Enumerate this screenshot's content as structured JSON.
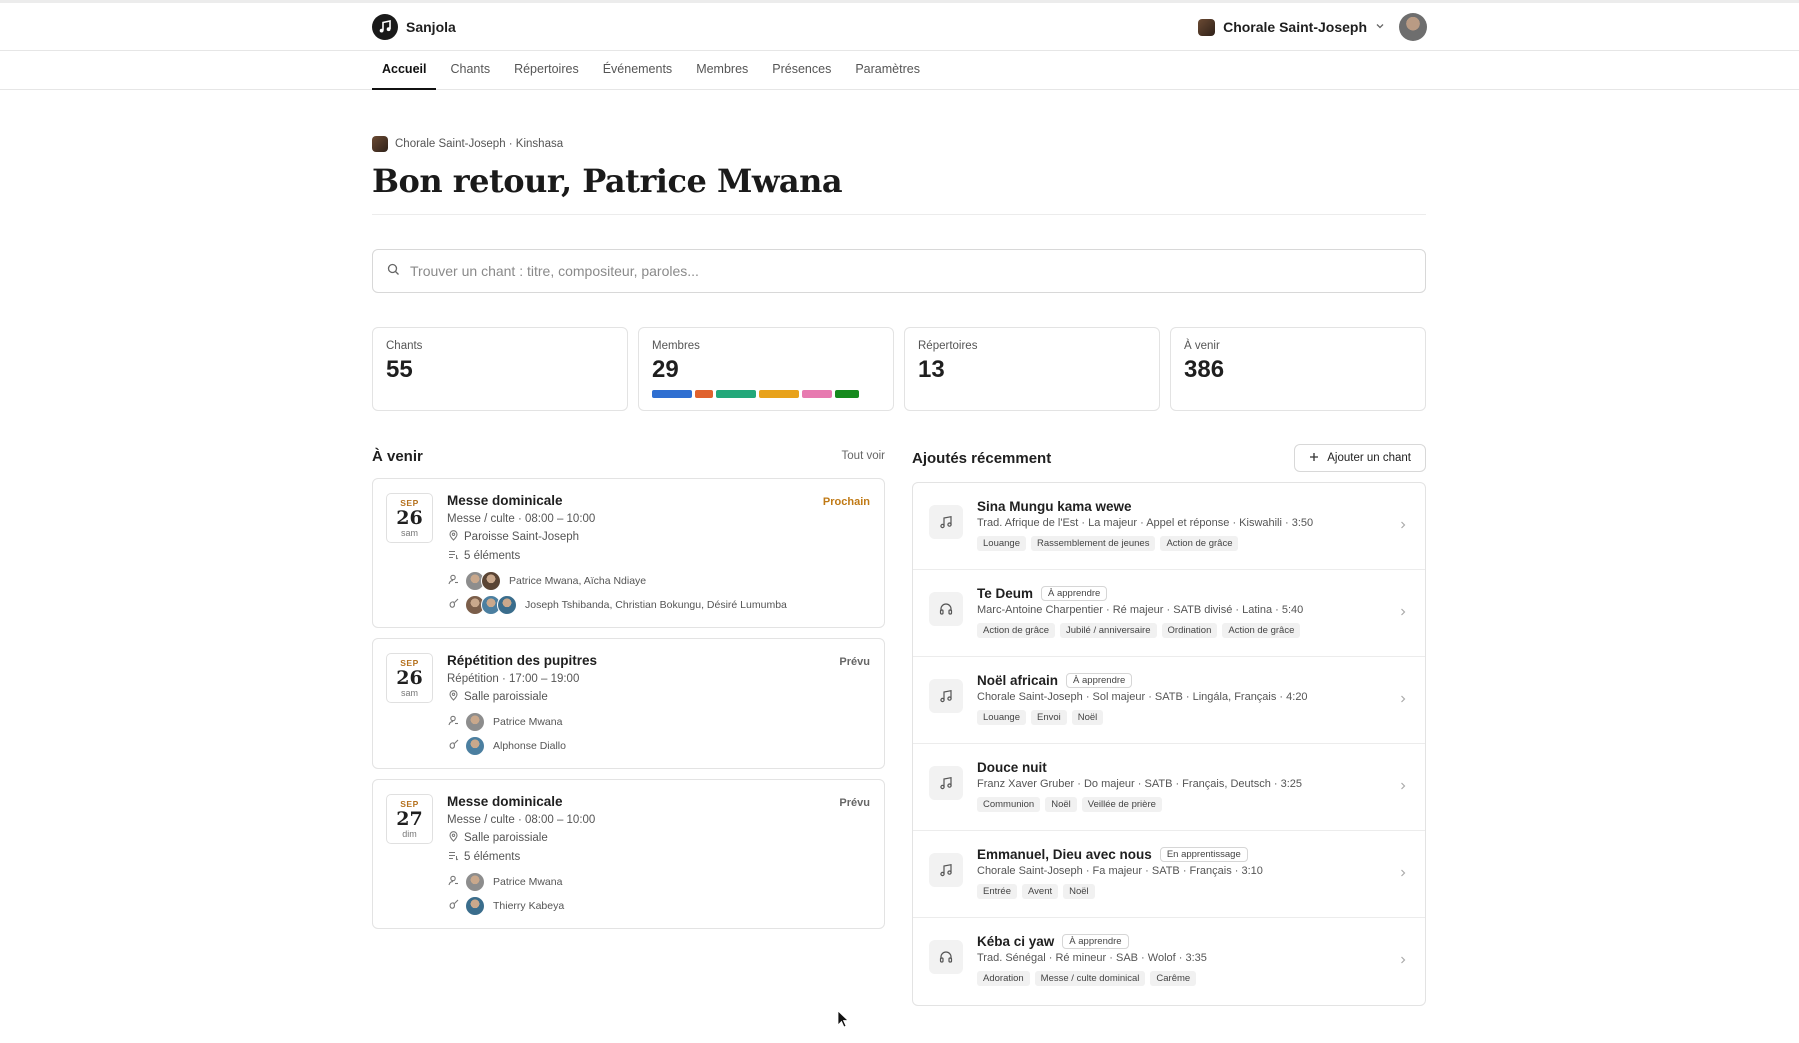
{
  "app": {
    "name": "Sanjola"
  },
  "org": {
    "name": "Chorale Saint-Joseph"
  },
  "tabs": [
    "Accueil",
    "Chants",
    "Répertoires",
    "Événements",
    "Membres",
    "Présences",
    "Paramètres"
  ],
  "breadcrumb": "Chorale Saint-Joseph · Kinshasa",
  "greeting": "Bon retour, Patrice Mwana",
  "search": {
    "placeholder": "Trouver un chant : titre, compositeur, paroles..."
  },
  "stats": [
    {
      "label": "Chants",
      "value": "55"
    },
    {
      "label": "Membres",
      "value": "29"
    },
    {
      "label": "Répertoires",
      "value": "13"
    },
    {
      "label": "À venir",
      "value": "386"
    }
  ],
  "voice_segments": [
    {
      "color": "#2f6fd1",
      "share": 0.2
    },
    {
      "color": "#e0622e",
      "share": 0.09
    },
    {
      "color": "#23a87a",
      "share": 0.2
    },
    {
      "color": "#e8a21b",
      "share": 0.2
    },
    {
      "color": "#e77ab0",
      "share": 0.15
    },
    {
      "color": "#168a1e",
      "share": 0.12
    }
  ],
  "upcoming": {
    "title": "À venir",
    "see_all": "Tout voir",
    "events": [
      {
        "month": "SEP",
        "day": "26",
        "weekday": "sam",
        "title": "Messe dominicale",
        "status": "Prochain",
        "is_next": true,
        "type_time": "Messe / culte · 08:00 – 10:00",
        "place": "Paroisse Saint-Joseph",
        "items": "5 éléments",
        "leaders": "Patrice Mwana, Aïcha Ndiaye",
        "leader_avatars": 2,
        "musicians": "Joseph Tshibanda, Christian Bokungu, Désiré Lumumba",
        "musician_avatars": 3
      },
      {
        "month": "SEP",
        "day": "26",
        "weekday": "sam",
        "title": "Répétition des pupitres",
        "status": "Prévu",
        "is_next": false,
        "type_time": "Répétition · 17:00 – 19:00",
        "place": "Salle paroissiale",
        "items": "",
        "leaders": "Patrice Mwana",
        "leader_avatars": 1,
        "musicians": "Alphonse Diallo",
        "musician_avatars": 1
      },
      {
        "month": "SEP",
        "day": "27",
        "weekday": "dim",
        "title": "Messe dominicale",
        "status": "Prévu",
        "is_next": false,
        "type_time": "Messe / culte · 08:00 – 10:00",
        "place": "Salle paroissiale",
        "items": "5 éléments",
        "leaders": "Patrice Mwana",
        "leader_avatars": 1,
        "musicians": "Thierry Kabeya",
        "musician_avatars": 1
      }
    ]
  },
  "recent": {
    "title": "Ajoutés récemment",
    "add_label": "Ajouter un chant",
    "songs": [
      {
        "icon": "music-note-icon",
        "title": "Sina Mungu kama wewe",
        "badge": "",
        "meta": "Trad. Afrique de l'Est · La majeur · Appel et réponse · Kiswahili · 3:50",
        "tags": [
          "Louange",
          "Rassemblement de jeunes",
          "Action de grâce"
        ]
      },
      {
        "icon": "headphones-icon",
        "title": "Te Deum",
        "badge": "À apprendre",
        "meta": "Marc-Antoine Charpentier · Ré majeur · SATB divisé · Latina · 5:40",
        "tags": [
          "Action de grâce",
          "Jubilé / anniversaire",
          "Ordination",
          "Action de grâce"
        ]
      },
      {
        "icon": "music-note-icon",
        "title": "Noël africain",
        "badge": "À apprendre",
        "meta": "Chorale Saint-Joseph · Sol majeur · SATB · Lingála, Français · 4:20",
        "tags": [
          "Louange",
          "Envoi",
          "Noël"
        ]
      },
      {
        "icon": "music-note-icon",
        "title": "Douce nuit",
        "badge": "",
        "meta": "Franz Xaver Gruber · Do majeur · SATB · Français, Deutsch · 3:25",
        "tags": [
          "Communion",
          "Noël",
          "Veillée de prière"
        ]
      },
      {
        "icon": "music-note-icon",
        "title": "Emmanuel, Dieu avec nous",
        "badge": "En apprentissage",
        "meta": "Chorale Saint-Joseph · Fa majeur · SATB · Français · 3:10",
        "tags": [
          "Entrée",
          "Avent",
          "Noël"
        ]
      },
      {
        "icon": "headphones-icon",
        "title": "Kéba ci yaw",
        "badge": "À apprendre",
        "meta": "Trad. Sénégal · Ré mineur · SAB · Wolof · 3:35",
        "tags": [
          "Adoration",
          "Messe / culte dominical",
          "Carême"
        ]
      }
    ]
  }
}
